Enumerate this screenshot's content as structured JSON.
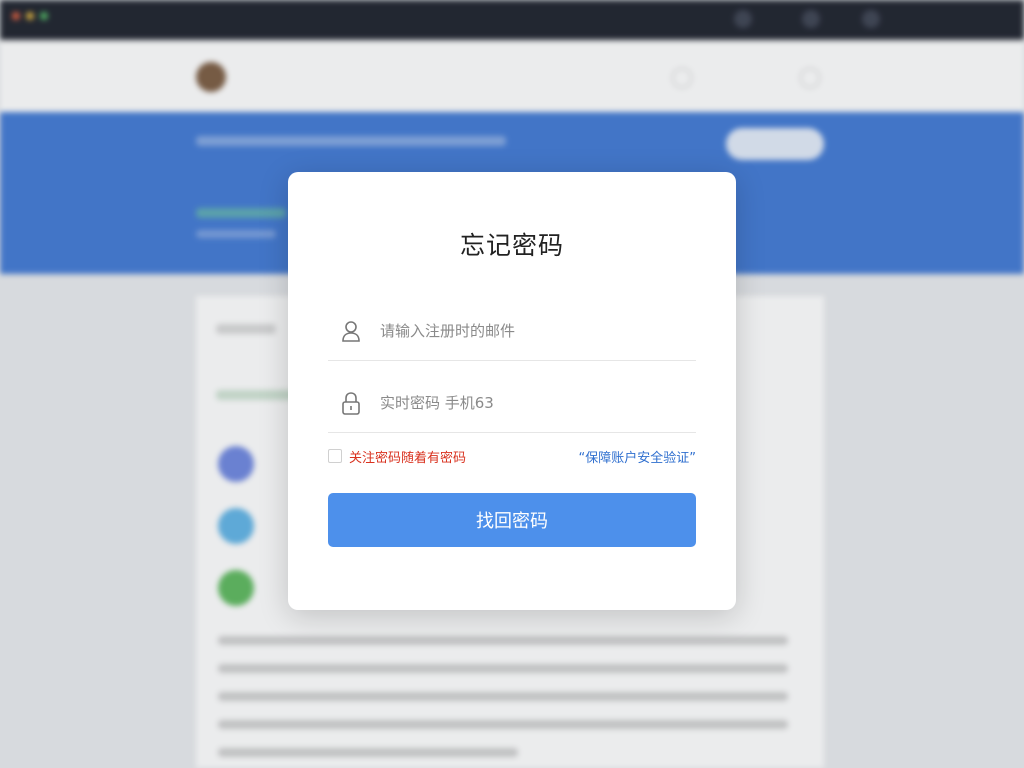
{
  "modal": {
    "title": "忘记密码",
    "account_field": {
      "placeholder": "请输入注册时的邮件"
    },
    "code_field": {
      "placeholder": "实时密码 手机63"
    },
    "remember_label": "关注密码随着有密码",
    "verify_link": "“保障账户安全验证”",
    "submit_label": "找回密码"
  },
  "colors": {
    "primary_button": "#4d90eb",
    "remember_text": "#d9321f",
    "link_text": "#2f6fcf",
    "hero_background": "#3f78d4"
  },
  "icons": {
    "account": "user-icon",
    "code": "lock-icon"
  }
}
